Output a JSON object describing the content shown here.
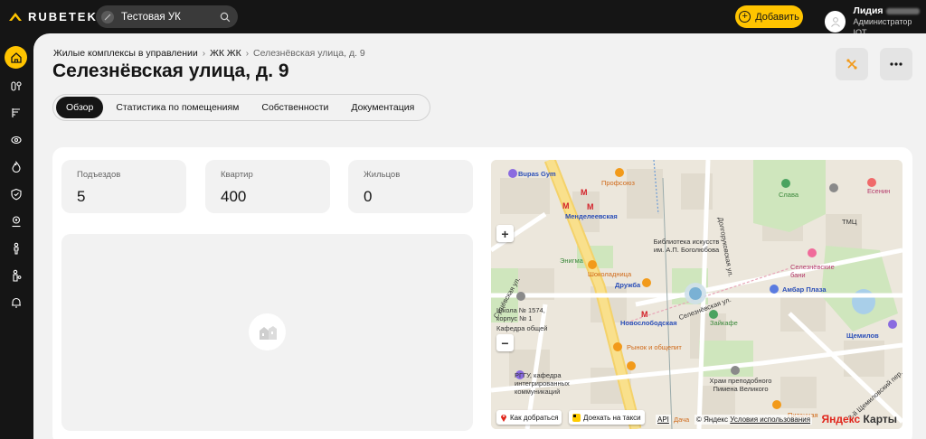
{
  "topbar": {
    "logo_text": "RUBETEK",
    "org_name": "Тестовая УК",
    "add_label": "Добавить",
    "user_name": "Лидия",
    "user_role": "Администратор IOT"
  },
  "sidebar": {
    "items": [
      {
        "icon": "home-icon",
        "active": true
      },
      {
        "icon": "devices-icon"
      },
      {
        "icon": "intercom-icon"
      },
      {
        "icon": "camera-icon"
      },
      {
        "icon": "fire-icon"
      },
      {
        "icon": "shield-icon"
      },
      {
        "icon": "person-badge-icon"
      },
      {
        "icon": "person-icon"
      },
      {
        "icon": "person-key-icon"
      },
      {
        "icon": "bell-icon"
      }
    ]
  },
  "breadcrumb": {
    "items": [
      "Жилые комплексы в управлении",
      "ЖК ЖК",
      "Селезнёвская улица, д. 9"
    ]
  },
  "page": {
    "title": "Селезнёвская улица, д. 9"
  },
  "tabs": [
    {
      "label": "Обзор",
      "active": true
    },
    {
      "label": "Статистика по помещениям"
    },
    {
      "label": "Собственности"
    },
    {
      "label": "Документация"
    }
  ],
  "stats": [
    {
      "label": "Подъездов",
      "value": "5"
    },
    {
      "label": "Квартир",
      "value": "400"
    },
    {
      "label": "Жильцов",
      "value": "0"
    }
  ],
  "map": {
    "labels": {
      "bupas": "Bupas Gym",
      "profsoyuz": "Профсоюз",
      "metro_mend": "Менделеевская",
      "slava": "Слава",
      "yesenin": "Есенин",
      "tmts": "ТМЦ",
      "library": "Библиотека искусств им. А.П. Боголюбова",
      "shokoladnitsa": "Шоколадница",
      "druzhba": "Дружба",
      "enigma": "Энигма",
      "banya": "Селезнёвские бани",
      "ambar": "Амбар Плаза",
      "metro_novo": "Новослободская",
      "zaykafe": "Зайкафе",
      "school": "Школа № 1574, корпус № 1",
      "kafedra": "Кафедра общей",
      "rynok": "Рынок и общепит",
      "rggu": "РГГУ, кафедра интегрированных коммуникаций",
      "khram": "Храм преподобного Пимена Великого",
      "shchemilov": "Щемилов",
      "pitannaya": "Питанная",
      "dacha": "Дача",
      "street_selez": "Селезнёвская ул.",
      "street_sush": "Сущёвская ул.",
      "street_dolg": "Долгоруковская ул.",
      "street_shchem": "2-й Щемиловский пер."
    },
    "route_label": "Как добраться",
    "taxi_label": "Доехать на такси",
    "api_label": "API",
    "copyright": "© Яндекс",
    "terms": "Условия использования",
    "brand_y": "Яндекс",
    "brand_rest": "Карты"
  }
}
